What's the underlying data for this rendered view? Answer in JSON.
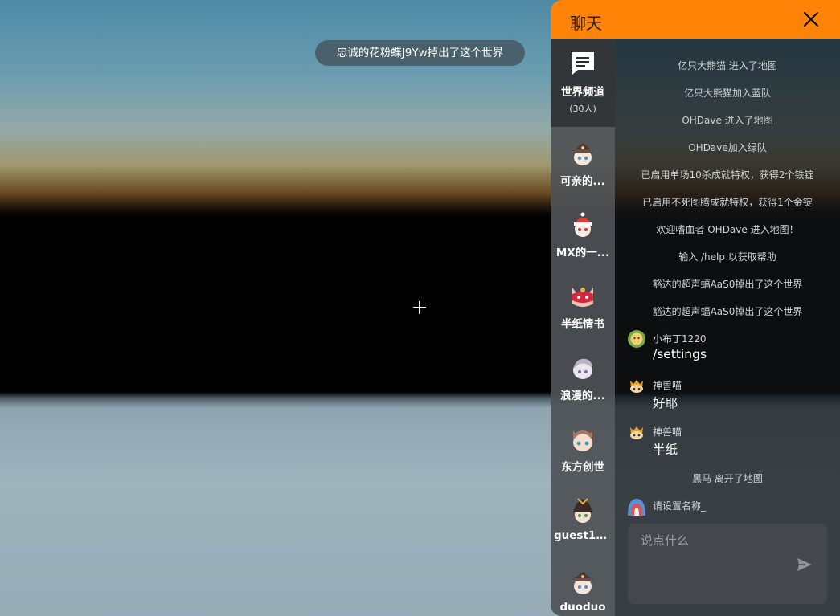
{
  "toast": "忠诚的花粉蝶J9Yw掉出了这个世界",
  "chat": {
    "title": "聊天",
    "world_channel": {
      "name": "世界频道",
      "count": "(30人)"
    },
    "contacts": [
      "可亲的...",
      "MX的一...",
      "半纸情书",
      "浪漫的...",
      "东方创世",
      "guest12...",
      "duoduo"
    ],
    "system_messages": [
      "亿只大熊猫 进入了地图",
      "亿只大熊猫加入蓝队",
      "OHDave 进入了地图",
      "OHDave加入绿队",
      "已启用单场10杀成就特权，获得2个铁锭",
      "已启用不死图腾成就特权，获得1个金锭",
      "欢迎嗜血者 OHDave 进入地图！",
      "输入 /help 以获取帮助",
      "豁达的超声蝠AaS0掉出了这个世界",
      "豁达的超声蝠AaS0掉出了这个世界"
    ],
    "user_messages": [
      {
        "name": "小布丁1220",
        "text": "/settings"
      },
      {
        "name": "神兽喵",
        "text": "好耶"
      },
      {
        "name": "神兽喵",
        "text": "半纸"
      }
    ],
    "system_after": "黑马 离开了地图",
    "last_user_name": "请设置名称_",
    "input_placeholder": "说点什么"
  },
  "colors": {
    "header": "#fe8307",
    "accent_text": "#ffffff"
  }
}
